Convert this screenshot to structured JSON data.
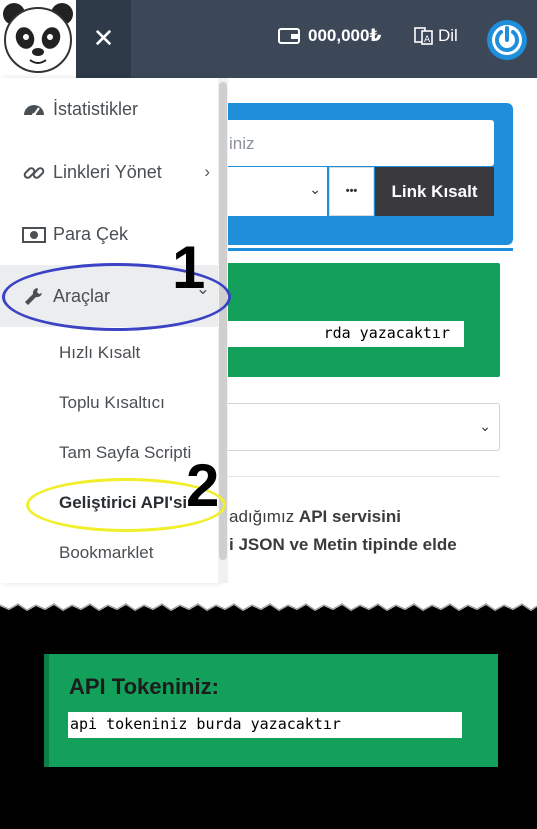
{
  "topbar": {
    "menu_toggle_glyph": "✕",
    "balance": "000,000₺",
    "language": "Dil"
  },
  "shortener": {
    "input_placeholder_fragment": "iniz",
    "more_glyph": "•••",
    "submit_label": "Link Kısalt"
  },
  "token_preview": {
    "value_fragment": "rda yazacaktır"
  },
  "description": {
    "line1_prefix": "adığımız ",
    "line1_bold": "API servisini",
    "line2": "i JSON ve Metin tipinde elde"
  },
  "sidebar": {
    "items": [
      {
        "label": "İstatistikler",
        "icon": "dashboard-icon"
      },
      {
        "label": "Linkleri Yönet",
        "icon": "link-icon",
        "arrow": "›"
      },
      {
        "label": "Para Çek",
        "icon": "money-icon"
      },
      {
        "label": "Araçlar",
        "icon": "wrench-icon",
        "arrow": "⌄"
      }
    ],
    "subitems": [
      {
        "label": "Hızlı Kısalt"
      },
      {
        "label": "Toplu Kısaltıcı"
      },
      {
        "label": "Tam Sayfa Scripti"
      },
      {
        "label": "Geliştirici API'si"
      },
      {
        "label": "Bookmarklet"
      }
    ]
  },
  "annotations": {
    "step1": "1",
    "step2": "2",
    "step1_color": "#3b43c4",
    "step2_color": "#f1ee2a"
  },
  "api_panel": {
    "title": "API Tokeniniz:",
    "token": "api tokeniniz burda yazacaktır"
  },
  "colors": {
    "topbar": "#3c4858",
    "accent_blue": "#1f8fdc",
    "success_green": "#12a05a"
  }
}
